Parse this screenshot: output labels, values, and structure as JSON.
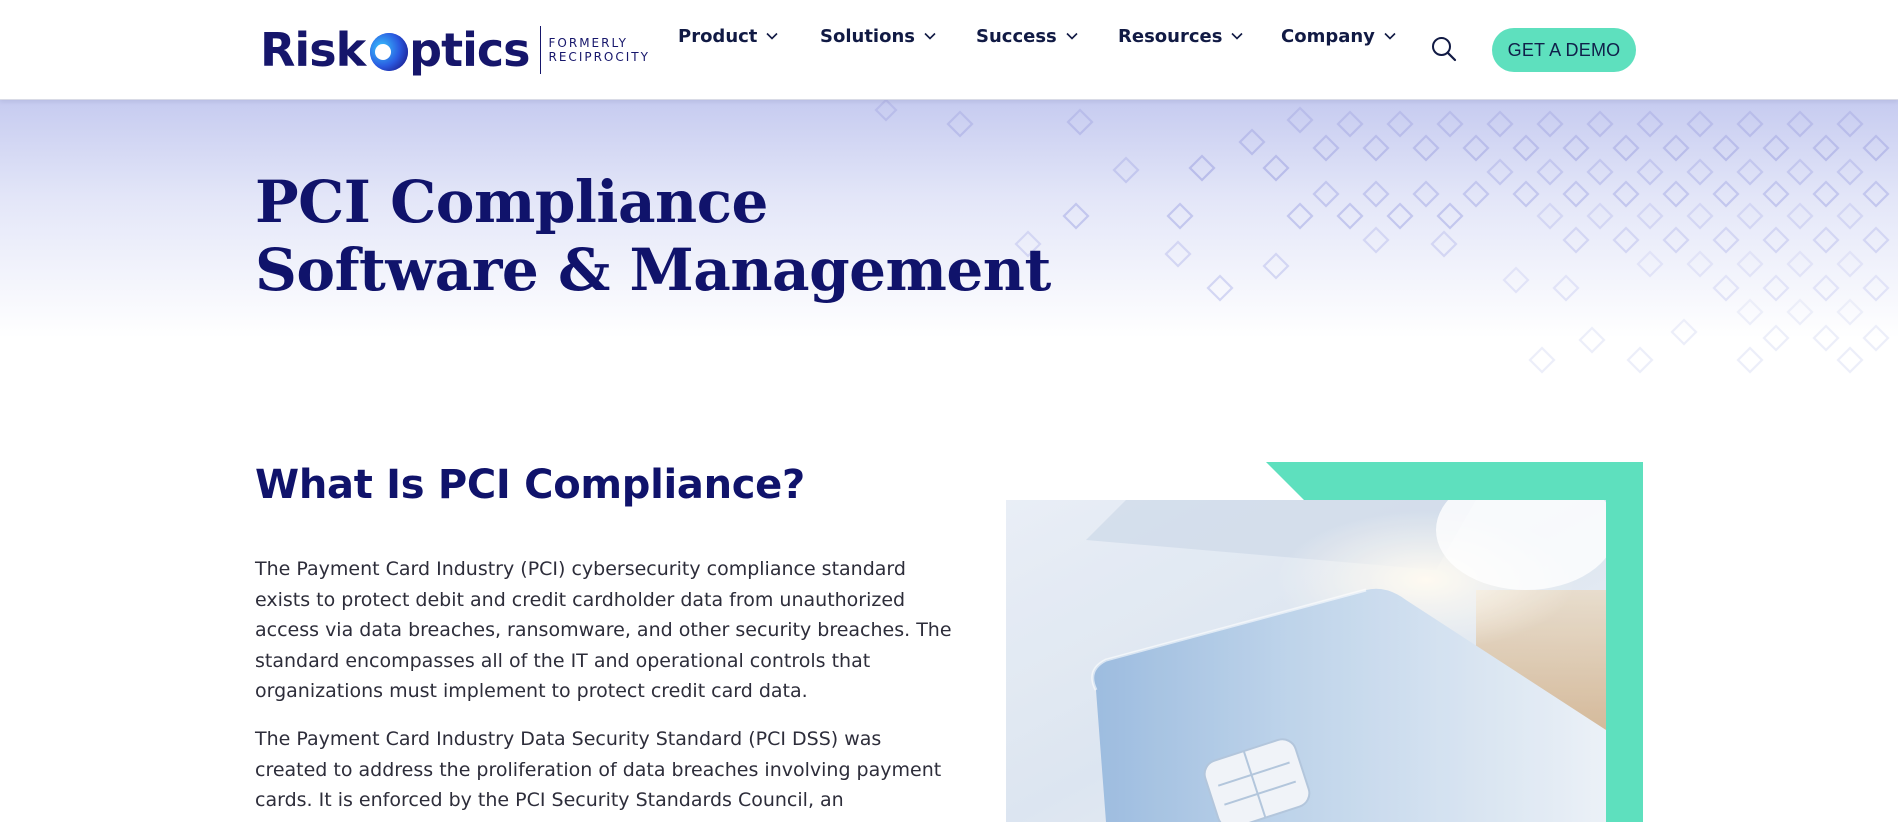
{
  "brand": {
    "name_part1": "Risk",
    "name_part2": "ptics",
    "formerly_line1": "FORMERLY",
    "formerly_line2": "RECIPROCITY",
    "navy": "#16166b",
    "accent": "#5ee0be"
  },
  "nav": {
    "items": [
      {
        "label": "Product",
        "icon": "chevron-down-icon"
      },
      {
        "label": "Solutions",
        "icon": "chevron-down-icon"
      },
      {
        "label": "Success",
        "icon": "chevron-down-icon"
      },
      {
        "label": "Resources",
        "icon": "chevron-down-icon"
      },
      {
        "label": "Company",
        "icon": "chevron-down-icon"
      }
    ],
    "search_icon": "search-icon",
    "cta_label": "GET A DEMO"
  },
  "hero": {
    "title_line1": "PCI Compliance",
    "title_line2": "Software & Management"
  },
  "main": {
    "section_title": "What Is PCI Compliance?",
    "paragraph1_lines": [
      "The Payment Card Industry (PCI) cybersecurity compliance standard",
      "exists to protect debit and credit cardholder data from unauthorized",
      "access via data breaches, ransomware, and other security breaches. The",
      "standard encompasses all of the IT and operational controls that",
      "organizations must implement to protect credit card data."
    ],
    "paragraph2_lines": [
      "The Payment Card Industry Data Security Standard (PCI DSS) was",
      "created to address the proliferation of data breaches involving payment",
      "cards. It is enforced by the PCI Security Standards Council, an"
    ],
    "image_subject": "credit-card-chip-photo"
  }
}
